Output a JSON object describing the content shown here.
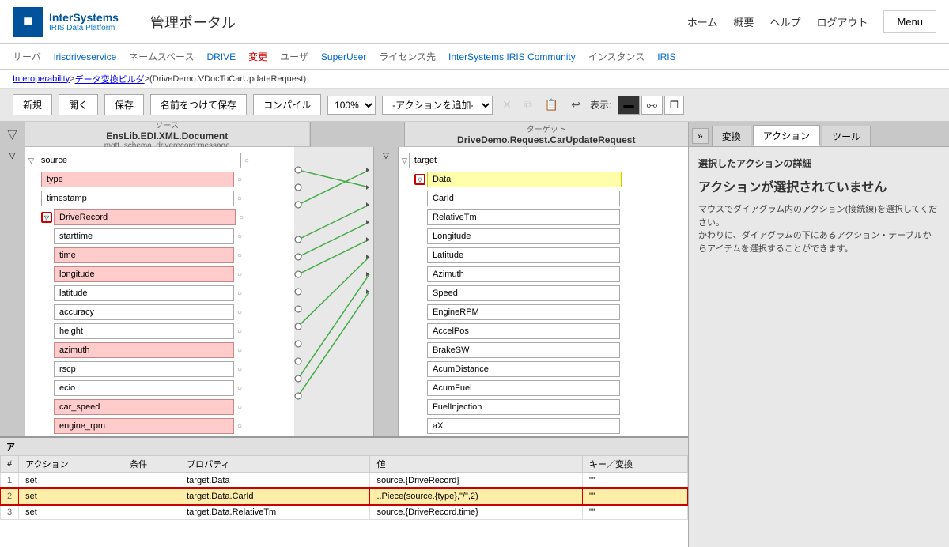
{
  "header": {
    "logo_brand": "InterSystems",
    "logo_product": "IRIS Data Platform",
    "title": "管理ポータル",
    "nav": {
      "home": "ホーム",
      "overview": "概要",
      "help": "ヘルプ",
      "logout": "ログアウト"
    },
    "menu_label": "Menu"
  },
  "subnav": {
    "server_label": "サーバ",
    "server_value": "irisdriveservice",
    "namespace_label": "ネームスペース",
    "namespace_value": "DRIVE",
    "change_label": "変更",
    "user_label": "ユーザ",
    "user_value": "SuperUser",
    "license_label": "ライセンス先",
    "license_value": "InterSystems IRIS Community",
    "instance_label": "インスタンス",
    "instance_value": "IRIS"
  },
  "breadcrumb": {
    "part1": "Interoperability",
    "sep1": " > ",
    "part2": "データ変換ビルダ",
    "sep2": " > ",
    "part3": "(DriveDemo.VDocToCarUpdateRequest)"
  },
  "toolbar": {
    "new_label": "新規",
    "open_label": "開く",
    "save_label": "保存",
    "save_as_label": "名前をつけて保存",
    "compile_label": "コンパイル",
    "zoom_value": "100%",
    "action_placeholder": "-アクションを追加-",
    "display_label": "表示:"
  },
  "diagram": {
    "source_label": "ソース",
    "source_class": "EnsLib.EDI.XML.Document",
    "source_sub": "mqtt_schema_driverecord:message",
    "target_label": "ターゲット",
    "target_class": "DriveDemo.Request.CarUpdateRequest",
    "source_fields": [
      {
        "name": "source",
        "level": 0,
        "expandable": true,
        "style": "normal"
      },
      {
        "name": "type",
        "level": 1,
        "expandable": false,
        "style": "pink"
      },
      {
        "name": "timestamp",
        "level": 1,
        "expandable": false,
        "style": "normal"
      },
      {
        "name": "DriveRecord",
        "level": 1,
        "expandable": true,
        "style": "pink",
        "highlighted": true
      },
      {
        "name": "starttime",
        "level": 2,
        "expandable": false,
        "style": "normal"
      },
      {
        "name": "time",
        "level": 2,
        "expandable": false,
        "style": "pink"
      },
      {
        "name": "longitude",
        "level": 2,
        "expandable": false,
        "style": "pink"
      },
      {
        "name": "latitude",
        "level": 2,
        "expandable": false,
        "style": "normal"
      },
      {
        "name": "accuracy",
        "level": 2,
        "expandable": false,
        "style": "normal"
      },
      {
        "name": "height",
        "level": 2,
        "expandable": false,
        "style": "normal"
      },
      {
        "name": "azimuth",
        "level": 2,
        "expandable": false,
        "style": "pink"
      },
      {
        "name": "rscp",
        "level": 2,
        "expandable": false,
        "style": "normal"
      },
      {
        "name": "ecio",
        "level": 2,
        "expandable": false,
        "style": "normal"
      },
      {
        "name": "car_speed",
        "level": 2,
        "expandable": false,
        "style": "pink"
      },
      {
        "name": "engine_rpm",
        "level": 2,
        "expandable": false,
        "style": "pink"
      }
    ],
    "target_fields": [
      {
        "name": "target",
        "level": 0,
        "expandable": true,
        "style": "normal"
      },
      {
        "name": "Data",
        "level": 1,
        "expandable": true,
        "style": "yellow",
        "highlighted": true
      },
      {
        "name": "CarId",
        "level": 2,
        "expandable": false,
        "style": "normal"
      },
      {
        "name": "RelativeTm",
        "level": 2,
        "expandable": false,
        "style": "normal"
      },
      {
        "name": "Longitude",
        "level": 2,
        "expandable": false,
        "style": "normal"
      },
      {
        "name": "Latitude",
        "level": 2,
        "expandable": false,
        "style": "normal"
      },
      {
        "name": "Azimuth",
        "level": 2,
        "expandable": false,
        "style": "normal"
      },
      {
        "name": "Speed",
        "level": 2,
        "expandable": false,
        "style": "normal"
      },
      {
        "name": "EngineRPM",
        "level": 2,
        "expandable": false,
        "style": "normal"
      },
      {
        "name": "AccelPos",
        "level": 2,
        "expandable": false,
        "style": "normal"
      },
      {
        "name": "BrakeSW",
        "level": 2,
        "expandable": false,
        "style": "normal"
      },
      {
        "name": "AcumDistance",
        "level": 2,
        "expandable": false,
        "style": "normal"
      },
      {
        "name": "AcumFuel",
        "level": 2,
        "expandable": false,
        "style": "normal"
      },
      {
        "name": "FuelInjection",
        "level": 2,
        "expandable": false,
        "style": "normal"
      },
      {
        "name": "aX",
        "level": 2,
        "expandable": false,
        "style": "normal"
      }
    ]
  },
  "bottom": {
    "label": "ア",
    "table": {
      "headers": [
        "#",
        "アクション",
        "条件",
        "プロパティ",
        "値",
        "キー／変換"
      ],
      "rows": [
        {
          "num": "1",
          "action": "set",
          "condition": "",
          "property": "target.Data",
          "value": "source.{DriveRecord}",
          "key": "\"\""
        },
        {
          "num": "2",
          "action": "set",
          "condition": "",
          "property": "target.Data.CarId",
          "value": "..Piece(source.{type},\"/\",2)",
          "key": "\"\"",
          "selected": true
        },
        {
          "num": "3",
          "action": "set",
          "condition": "",
          "property": "target.Data.RelativeTm",
          "value": "source.{DriveRecord.time}",
          "key": "\"\""
        }
      ]
    }
  },
  "right_panel": {
    "toggle_label": "»",
    "tabs": [
      "変換",
      "アクション",
      "ツール"
    ],
    "active_tab": "アクション",
    "section_title": "選択したアクションの詳細",
    "main_title": "アクションが選択されていません",
    "description": "マウスでダイアグラム内のアクション(接続線)を選択してください。\nかわりに、ダイアグラムの下にあるアクション・テーブルからアイテムを選択することができます。"
  }
}
